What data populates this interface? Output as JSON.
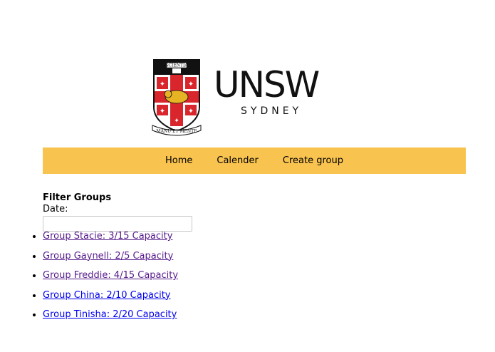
{
  "logo": {
    "wordmark": "UNSW",
    "subtext": "SYDNEY",
    "crest_scroll_top": "SCIENTIA",
    "crest_motto": "MANU ET MENTE"
  },
  "nav": {
    "items": [
      {
        "label": "Home"
      },
      {
        "label": "Calender"
      },
      {
        "label": "Create group"
      }
    ],
    "background": "#f9c34f"
  },
  "filter": {
    "title": "Filter Groups",
    "date_label": "Date:",
    "date_value": "",
    "date_placeholder": ""
  },
  "groups": [
    {
      "label": "Group Stacie: 3/15 Capacity",
      "visited": true
    },
    {
      "label": "Group Gaynell: 2/5 Capacity",
      "visited": true
    },
    {
      "label": "Group Freddie: 4/15 Capacity",
      "visited": true
    },
    {
      "label": "Group China: 2/10 Capacity",
      "visited": false
    },
    {
      "label": "Group Tinisha: 2/20 Capacity",
      "visited": false
    }
  ],
  "colors": {
    "visited_link": "#551a8b",
    "unvisited_link": "#0000ee",
    "crest_red": "#d9262c",
    "crest_gold": "#e6b325"
  }
}
